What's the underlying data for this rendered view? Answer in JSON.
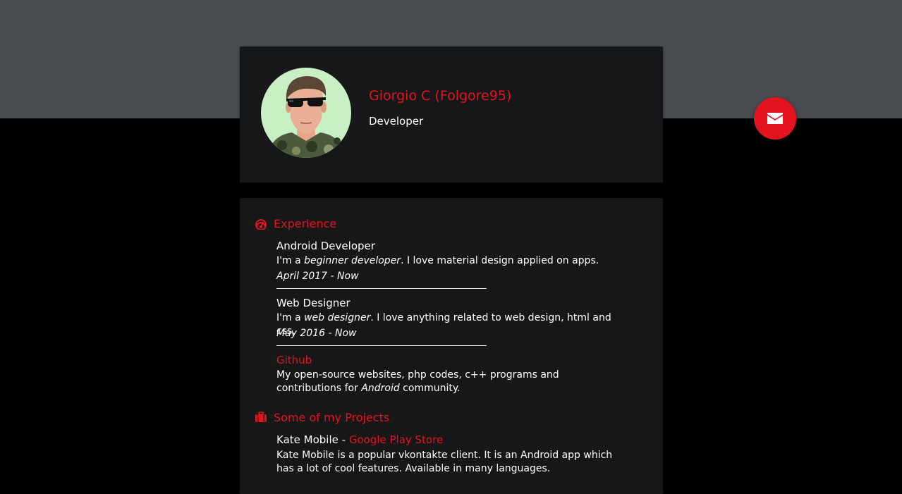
{
  "profile": {
    "name": "Giorgio C (Folgore95)",
    "role": "Developer"
  },
  "contact": {
    "icon": "envelope-icon"
  },
  "experience": {
    "title": "Experience",
    "icon": "dashboard-icon",
    "items": [
      {
        "title": "Android Developer",
        "text_before": "I'm a ",
        "text_emph": "beginner developer",
        "text_after": ". I love material design applied on apps.",
        "date": "April 2017 - Now"
      },
      {
        "title": "Web Designer",
        "text_before": "I'm a ",
        "text_emph": "web designer",
        "text_after": ". I love anything related to web design, html and css.",
        "date": "May 2016 - Now"
      },
      {
        "title": "Github",
        "text_before": "My open-source websites, php codes, c++ programs and contributions for ",
        "text_emph": "Android",
        "text_after": " community."
      }
    ]
  },
  "projects": {
    "title": "Some of my Projects",
    "icon": "briefcase-icon",
    "items": [
      {
        "title": "Kate Mobile",
        "separator": " - ",
        "link": "Google Play Store",
        "text": "Kate Mobile is a popular vkontakte client. It is an Android app which has a lot of cool features. Available in many languages."
      }
    ]
  },
  "colors": {
    "accent": "#e3141e",
    "top_band": "#484b50",
    "card": "#161719",
    "background": "#000000"
  }
}
